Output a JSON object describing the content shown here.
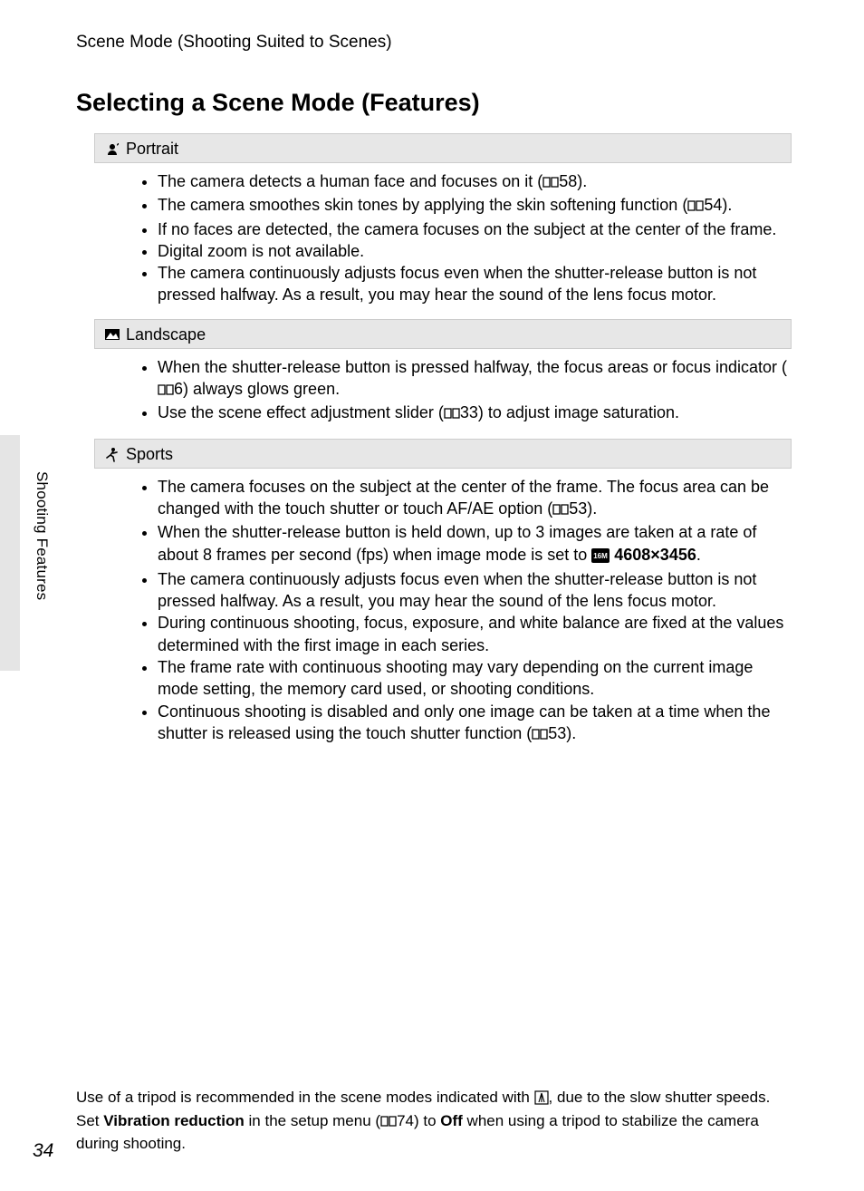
{
  "breadcrumb": "Scene Mode (Shooting Suited to Scenes)",
  "page_title": "Selecting a Scene Mode (Features)",
  "side_tab": "Shooting Features",
  "page_number": "34",
  "sections": {
    "portrait": {
      "title": "Portrait",
      "items": {
        "0a": "The camera detects a human face and focuses on it (",
        "0b": "58).",
        "1a": "The camera smoothes skin tones by applying the skin softening function (",
        "1b": "54).",
        "2": "If no faces are detected, the camera focuses on the subject at the center of the frame.",
        "3": "Digital zoom is not available.",
        "4": "The camera continuously adjusts focus even when the shutter-release button is not pressed halfway. As a result, you may hear the sound of the lens focus motor."
      }
    },
    "landscape": {
      "title": "Landscape",
      "items": {
        "0a": "When the shutter-release button is pressed halfway, the focus areas or focus indicator (",
        "0b": "6) always glows green.",
        "1a": "Use the scene effect adjustment slider (",
        "1b": "33) to adjust image saturation."
      }
    },
    "sports": {
      "title": "Sports",
      "items": {
        "0a": "The camera focuses on the subject at the center of the frame. The focus area can be changed with the touch shutter or touch AF/AE option (",
        "0b": "53).",
        "1a": "When the shutter-release button is held down, up to 3 images are taken at a rate of about 8 frames per second (fps) when image mode is set to ",
        "1b": " 4608×3456",
        "1c": ".",
        "2": "The camera continuously adjusts focus even when the shutter-release button is not pressed halfway. As a result, you may hear the sound of the lens focus motor.",
        "3": "During continuous shooting, focus, exposure, and white balance are fixed at the values determined with the first image in each series.",
        "4": "The frame rate with continuous shooting may vary depending on the current image mode setting, the memory card used, or shooting conditions.",
        "5a": "Continuous shooting is disabled and only one image can be taken at a time when the shutter is released using the touch shutter function (",
        "5b": "53)."
      }
    }
  },
  "footer": {
    "a": "Use of a tripod is recommended in the scene modes indicated with ",
    "b": ", due to the slow shutter speeds. Set ",
    "c": "Vibration reduction",
    "d": " in the setup menu (",
    "e": "74) to ",
    "f": "Off",
    "g": " when using a tripod to stabilize the camera during shooting."
  }
}
